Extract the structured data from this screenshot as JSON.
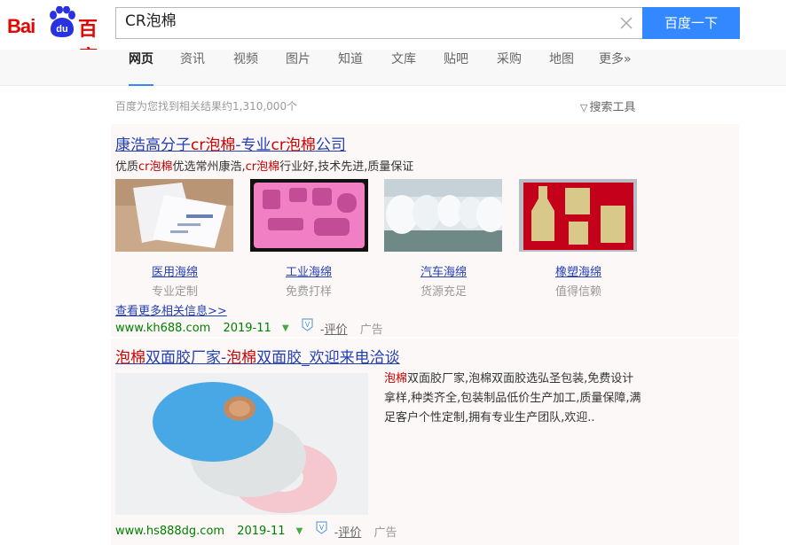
{
  "logo": {
    "bai": "Bai",
    "du": "du",
    "cn": "百度"
  },
  "search": {
    "query": "CR泡棉",
    "button_label": "百度一下"
  },
  "nav": {
    "items": [
      {
        "label": "网页",
        "active": true
      },
      {
        "label": "资讯"
      },
      {
        "label": "视频"
      },
      {
        "label": "图片"
      },
      {
        "label": "知道"
      },
      {
        "label": "文库"
      },
      {
        "label": "贴吧"
      },
      {
        "label": "采购"
      },
      {
        "label": "地图"
      },
      {
        "label": "更多»"
      }
    ]
  },
  "result_count": "百度为您找到相关结果约1,310,000个",
  "tools_label": "搜索工具",
  "result1": {
    "title_parts": [
      "康浩高分子",
      "cr泡棉",
      "-专业",
      "cr泡棉",
      "公司"
    ],
    "desc_parts": [
      "优质",
      "cr泡棉",
      "优选常州康浩,",
      "cr泡棉",
      "行业好,技术先进,质量保证"
    ],
    "thumbs": [
      {
        "label": "医用海绵",
        "sub": "专业定制"
      },
      {
        "label": "工业海绵",
        "sub": "免费打样"
      },
      {
        "label": "汽车海绵",
        "sub": "货源充足"
      },
      {
        "label": "橡塑海绵",
        "sub": "值得信赖"
      }
    ],
    "more_link": "查看更多相关信息>>",
    "url": "www.kh688.com",
    "date": "2019-11",
    "rate_prefix": "- ",
    "rate": "评价",
    "ad": "广告"
  },
  "result2": {
    "title_parts": [
      "泡棉",
      "双面胶厂家-",
      "泡棉",
      "双面胶_欢迎来电洽谈"
    ],
    "desc_hl": "泡棉",
    "desc_text": "双面胶厂家,泡棉双面胶选弘圣包装,免费设计拿样,种类齐全,包装制品低价生产加工,质量保障,满足客户个性定制,拥有专业生产团队,欢迎..",
    "url": "www.hs888dg.com",
    "date": "2019-11",
    "rate_prefix": "- ",
    "rate": "评价",
    "ad": "广告"
  },
  "colors": {
    "accent": "#3388ff",
    "link": "#2440b3",
    "highlight": "#cc0000",
    "url_green": "#008000",
    "logo_red": "#e10602",
    "paw_blue": "#2932e1"
  },
  "icons": [
    "paw-icon",
    "clear-icon",
    "funnel-icon",
    "dropdown-triangle-icon",
    "v-certified-icon"
  ]
}
